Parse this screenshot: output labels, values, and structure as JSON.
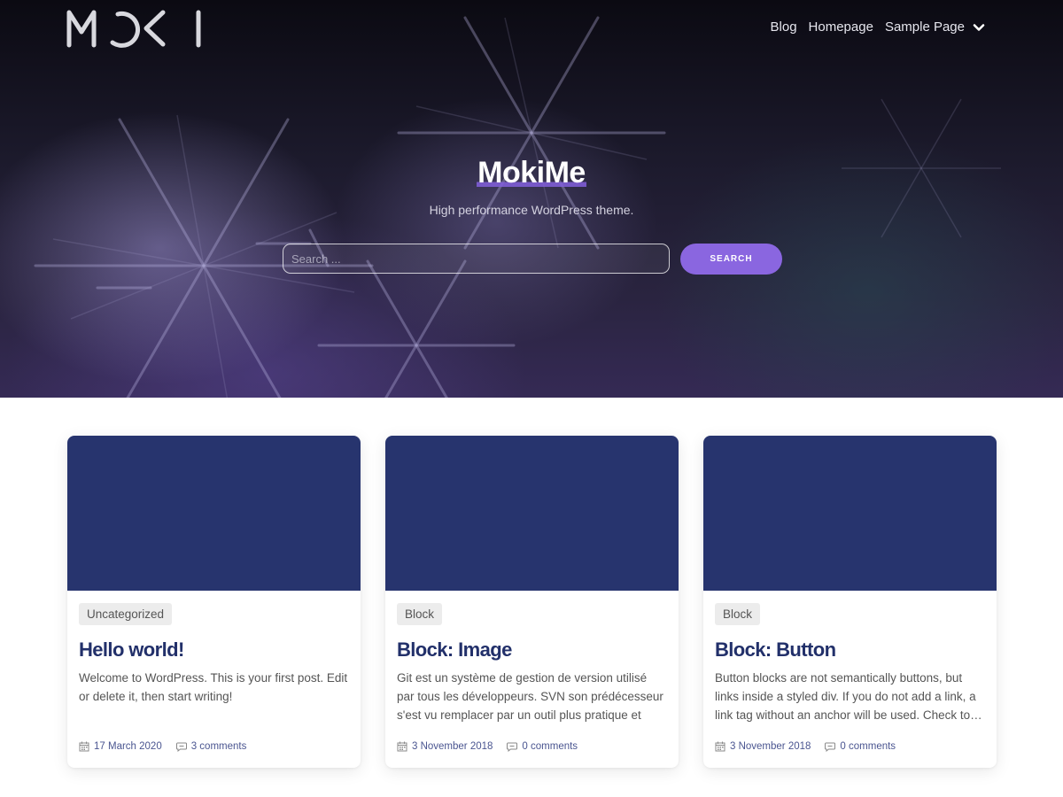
{
  "site": {
    "logo_text": "MOKI",
    "title": "MokiMe",
    "tagline": "High performance WordPress theme."
  },
  "nav": {
    "items": [
      {
        "label": "Blog"
      },
      {
        "label": "Homepage"
      },
      {
        "label": "Sample Page"
      }
    ],
    "dropdown_icon": "chevron-down-icon"
  },
  "search": {
    "placeholder": "Search ...",
    "value": "",
    "button_label": "SEARCH"
  },
  "colors": {
    "accent": "#8a66e0",
    "card_image": "#27346e",
    "title": "#22306a"
  },
  "posts": [
    {
      "category": "Uncategorized",
      "title": "Hello world!",
      "excerpt": "Welcome to WordPress. This is your first post. Edit or delete it, then start writing!",
      "date": "17 March 2020",
      "comments": "3 comments"
    },
    {
      "category": "Block",
      "title": "Block: Image",
      "excerpt": "Git est un système de gestion de version utilisé par tous les développeurs. SVN son prédécesseur s'est vu remplacer par un outil plus pratique et plus…",
      "date": "3 November 2018",
      "comments": "0 comments"
    },
    {
      "category": "Block",
      "title": "Block: Button",
      "excerpt": "Button blocks are not semantically buttons, but links inside a styled div.  If you do not add a link, a link tag without an anchor will be used. Check to…",
      "date": "3 November 2018",
      "comments": "0 comments"
    }
  ]
}
